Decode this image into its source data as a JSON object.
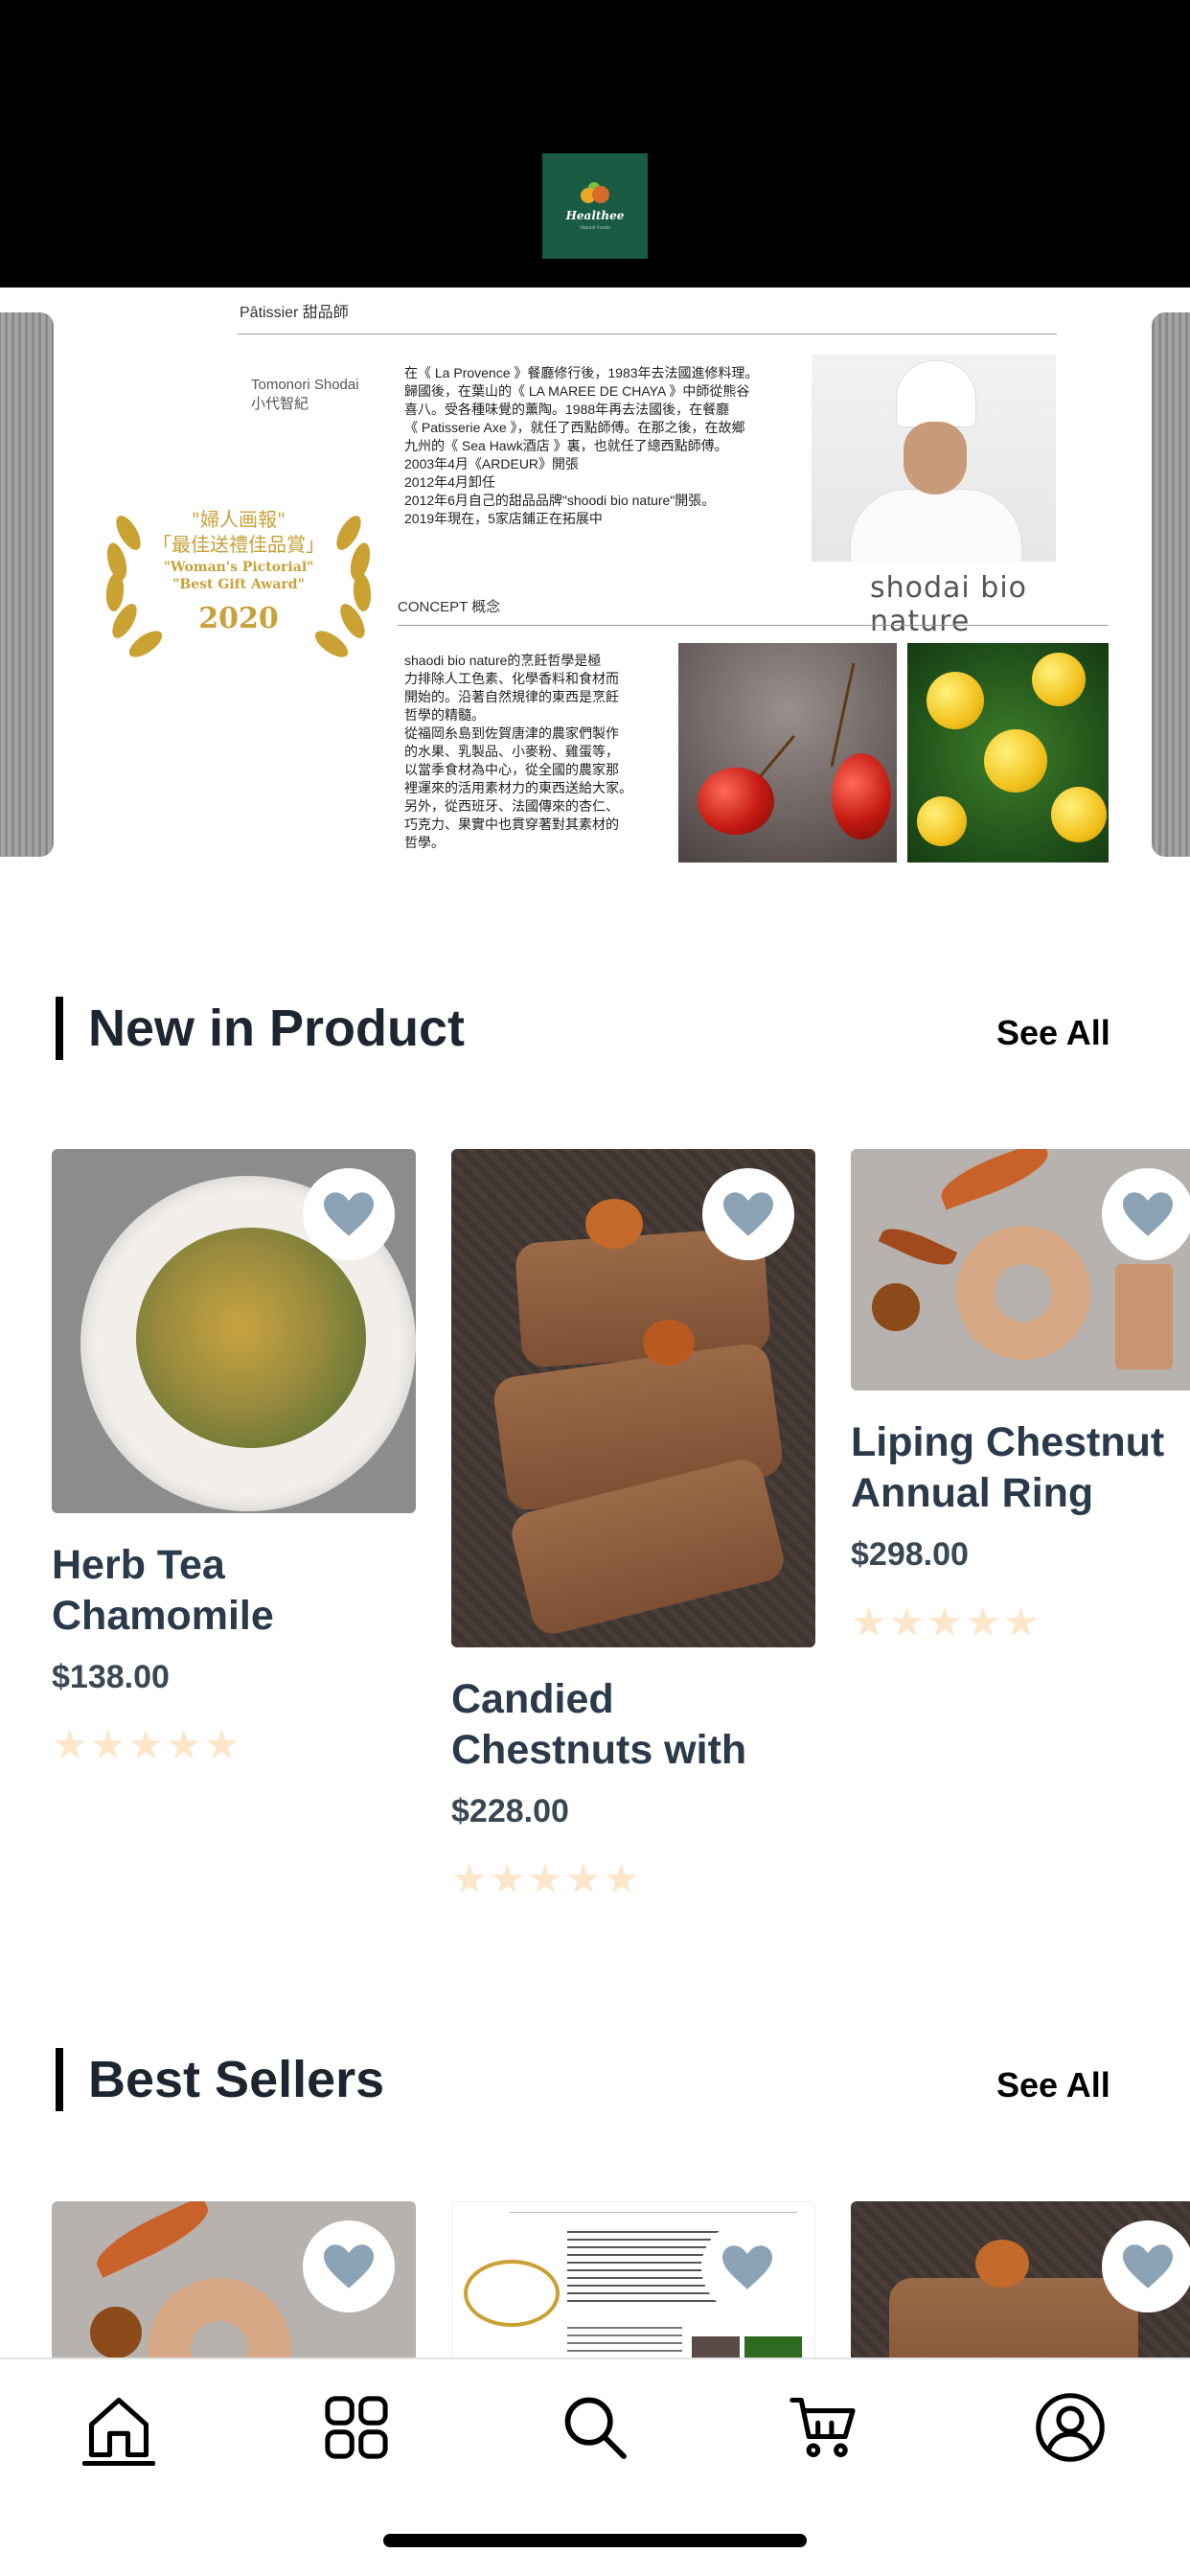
{
  "header": {
    "logo_name": "Healthee",
    "logo_tagline": "Natural Foods"
  },
  "banner": {
    "patissier_label": "Pâtissier  甜品師",
    "chef_name_en": "Tomonori Shodai",
    "chef_name_zh": "小代智紀",
    "bio_lines": [
      "在《 La Provence 》餐廳修行後，1983年去法國進修料理。",
      "歸國後，在葉山的《 LA MAREE DE CHAYA 》中師從熊谷",
      "喜八。受各種味覺的薰陶。1988年再去法國後，在餐廳",
      "《 Patisserie Axe 》，就任了西點師傅。在那之後，在故鄉",
      "九州的《 Sea Hawk酒店 》裏，也就任了總西點師傅。",
      "2003年4月《ARDEUR》開張",
      "2012年4月卸任",
      "2012年6月自己的甜品品牌\"shoodi bio nature\"開張。",
      "2019年現在，5家店鋪正在拓展中"
    ],
    "brand_script": "shodai bio nature",
    "award_line1": "\"婦人画報\"",
    "award_line2": "「最佳送禮佳品賞」",
    "award_line3": "\"Woman's Pictorial\"",
    "award_line4": "\"Best Gift Award\"",
    "award_year": "2020",
    "concept_label": "CONCEPT  概念",
    "concept_lines": [
      "shaodi bio nature的烹飪哲學是極",
      "力排除人工色素、化學香料和食材而",
      "開始的。沿著自然規律的東西是烹飪",
      "哲學的精髓。",
      "從福岡糸島到佐賀唐津的農家們製作",
      "的水果、乳製品、小麥粉、雞蛋等，",
      "以當季食材為中心，從全國的農家那",
      "裡運來的活用素材力的東西送給大家。",
      "另外，從西班牙、法國傳來的杏仁、",
      "巧克力、果實中也貫穿著對其素材的",
      "哲學。"
    ]
  },
  "new_in_product": {
    "title": "New in Product",
    "see_all": "See All",
    "items": [
      {
        "title": "Herb Tea\nChamomile",
        "price": "$138.00",
        "stars": "★★★★★"
      },
      {
        "title": "Candied\nChestnuts with",
        "price": "$228.00",
        "stars": "★★★★★"
      },
      {
        "title": "Liping Chestnut\nAnnual Ring",
        "price": "$298.00",
        "stars": "★★★★★"
      }
    ]
  },
  "best_sellers": {
    "title": "Best Sellers",
    "see_all": "See All"
  },
  "tabs": [
    "home-icon",
    "grid-icon",
    "search-icon",
    "cart-icon",
    "profile-icon"
  ],
  "colors": {
    "accent_star": "#fde6ca",
    "heart": "#8ba3b5",
    "logo_bg": "#1a5b43"
  }
}
